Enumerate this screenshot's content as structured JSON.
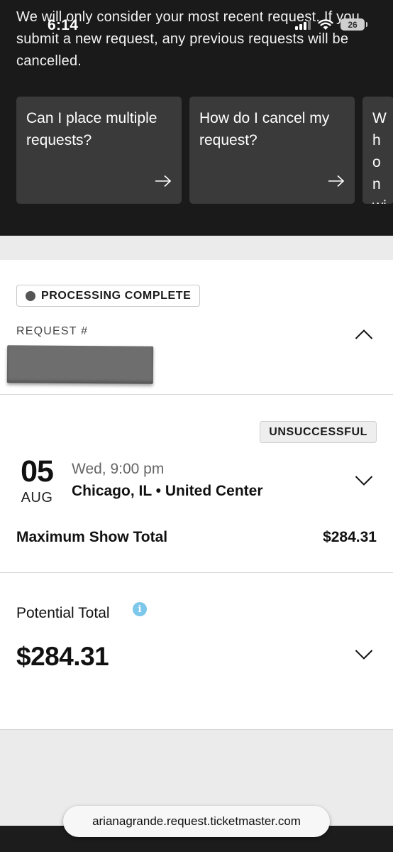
{
  "status_bar": {
    "time": "6:14",
    "battery": "26"
  },
  "notice": {
    "text": "We will only consider your most recent request. If you submit a new request, any previous requests will be cancelled."
  },
  "faq_cards": [
    {
      "label": "Can I place multiple requests?"
    },
    {
      "label": "How do I cancel my request?"
    },
    {
      "label": "Wh on wi"
    }
  ],
  "request": {
    "status_label": "PROCESSING COMPLETE",
    "request_number_label": "REQUEST #",
    "event": {
      "result_badge": "UNSUCCESSFUL",
      "day": "05",
      "month": "AUG",
      "time": "Wed, 9:00 pm",
      "venue": "Chicago, IL • United Center",
      "max_total_label": "Maximum Show Total",
      "max_total_value": "$284.31"
    },
    "potential": {
      "label": "Potential Total",
      "info_glyph": "i",
      "value": "$284.31"
    }
  },
  "browser": {
    "url": "arianagrande.request.ticketmaster.com"
  },
  "colors": {
    "dark_bg": "#1a1a1a",
    "card_bg": "#3a3a3a",
    "info_accent": "#7cc7ea",
    "page_gray": "#ebebeb"
  }
}
